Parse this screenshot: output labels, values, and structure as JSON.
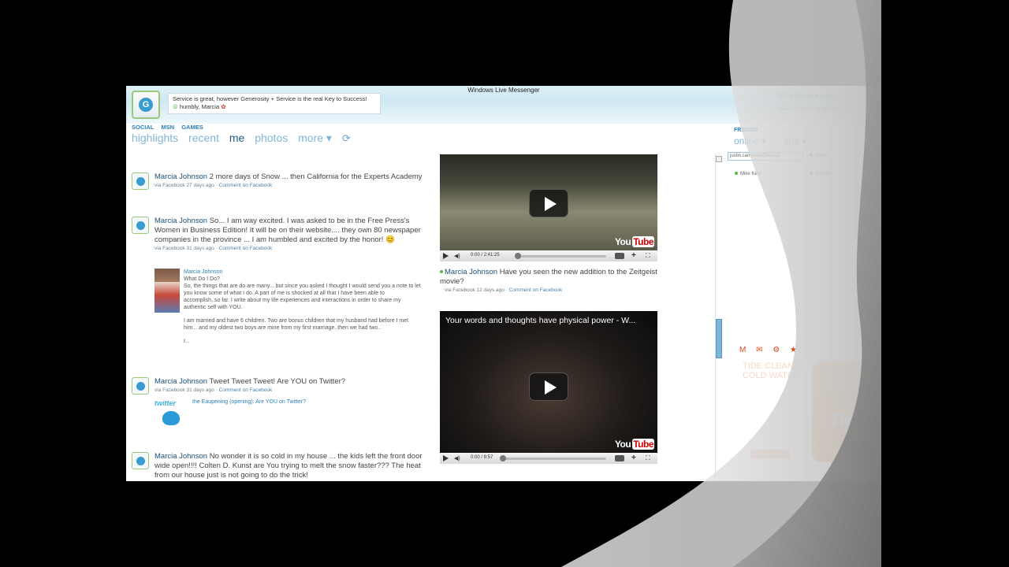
{
  "window": {
    "title": "Windows Live Messenger"
  },
  "profile": {
    "status_line1": "Service is great, however Generosity + Service is the real Key to Success!",
    "status_line2": "humbly, Marcia"
  },
  "nav": {
    "small": [
      "SOCIAL",
      "MSN",
      "GAMES"
    ],
    "tabs": [
      "highlights",
      "recent",
      "me",
      "photos",
      "more ▾"
    ],
    "refresh_icon": "⟳"
  },
  "feed": [
    {
      "name": "Marcia Johnson",
      "text": "2 more days of Snow ... then California for the Experts Academy",
      "meta": "via Facebook 27 days ago",
      "comment": "Comment on Facebook"
    },
    {
      "name": "Marcia Johnson",
      "text": "So... I am way excited. I was asked to be in the Free Press's Women in Business Edition! It will be on their website.... they own 80 newspaper companies in the province ... I am humbled and excited by the honor! 😊",
      "meta": "via Facebook 31 days ago",
      "comment": "Comment on Facebook"
    },
    {
      "name": "Marcia Johnson",
      "text": "Tweet Tweet Tweet! Are YOU on Twitter?",
      "meta": "via Facebook 31 days ago",
      "comment": "Comment on Facebook"
    },
    {
      "name": "Marcia Johnson",
      "text": "No wonder it is so cold in my house ... the kids left the front door wide open!!!! Colten D. Kunst are You trying to melt the snow faster??? The heat from our house just is not going to do the trick!",
      "meta": "",
      "comment": ""
    }
  ],
  "shared_post": {
    "name": "Marcia Johnson",
    "title": "What Do I Do?",
    "para1": "So, the things that are do are many... but since you asked I thought I would send you a note to let you know some of what I do. A part of me is shocked at all that I have been able to accomplish..so far. I write about my life experiences and interactions in order to share my authentic self with YOU.",
    "para2": "I am married and have 6 children. Two are bonus children that my husband had before I met him... and my oldest two boys are mine from my first marriage..then we had two..",
    "para3": "I..."
  },
  "twitter_share": {
    "logo": "twitter",
    "link": "the Eaupening (opening): Are YOU on Twitter?"
  },
  "videos": [
    {
      "title": "",
      "time": "0:00 / 2:41:25",
      "brand": "You",
      "brand2": "Tube",
      "progress": 0.0
    },
    {
      "title": "Your words and thoughts have physical power - W...",
      "time": "0:00 / 9:57",
      "brand": "You",
      "brand2": "Tube",
      "progress": 0.0
    }
  ],
  "video_caption": {
    "name": "Marcia Johnson",
    "text": "Have you seen the new addition to the Zeitgeist movie?",
    "meta": "via Facebook 12 days ago",
    "comment": "Comment on Facebook"
  },
  "friends": {
    "heading": "FRIENDS",
    "tabs": [
      "online ▾",
      "add ▾"
    ],
    "search_value": "justin.campbell@live.ca",
    "list": [
      "Bonus",
      "Mike Kent",
      "RADIO..."
    ]
  },
  "top_right": {
    "user": "Marcia Johnson ▾",
    "inbox": "inbox",
    "search_placeholder": "Search contacts or the web"
  },
  "ad": {
    "icons": "M ✉ ⚙ ★",
    "copy": "Tide cleaning fresh even in cold water",
    "brand": "Tide"
  }
}
